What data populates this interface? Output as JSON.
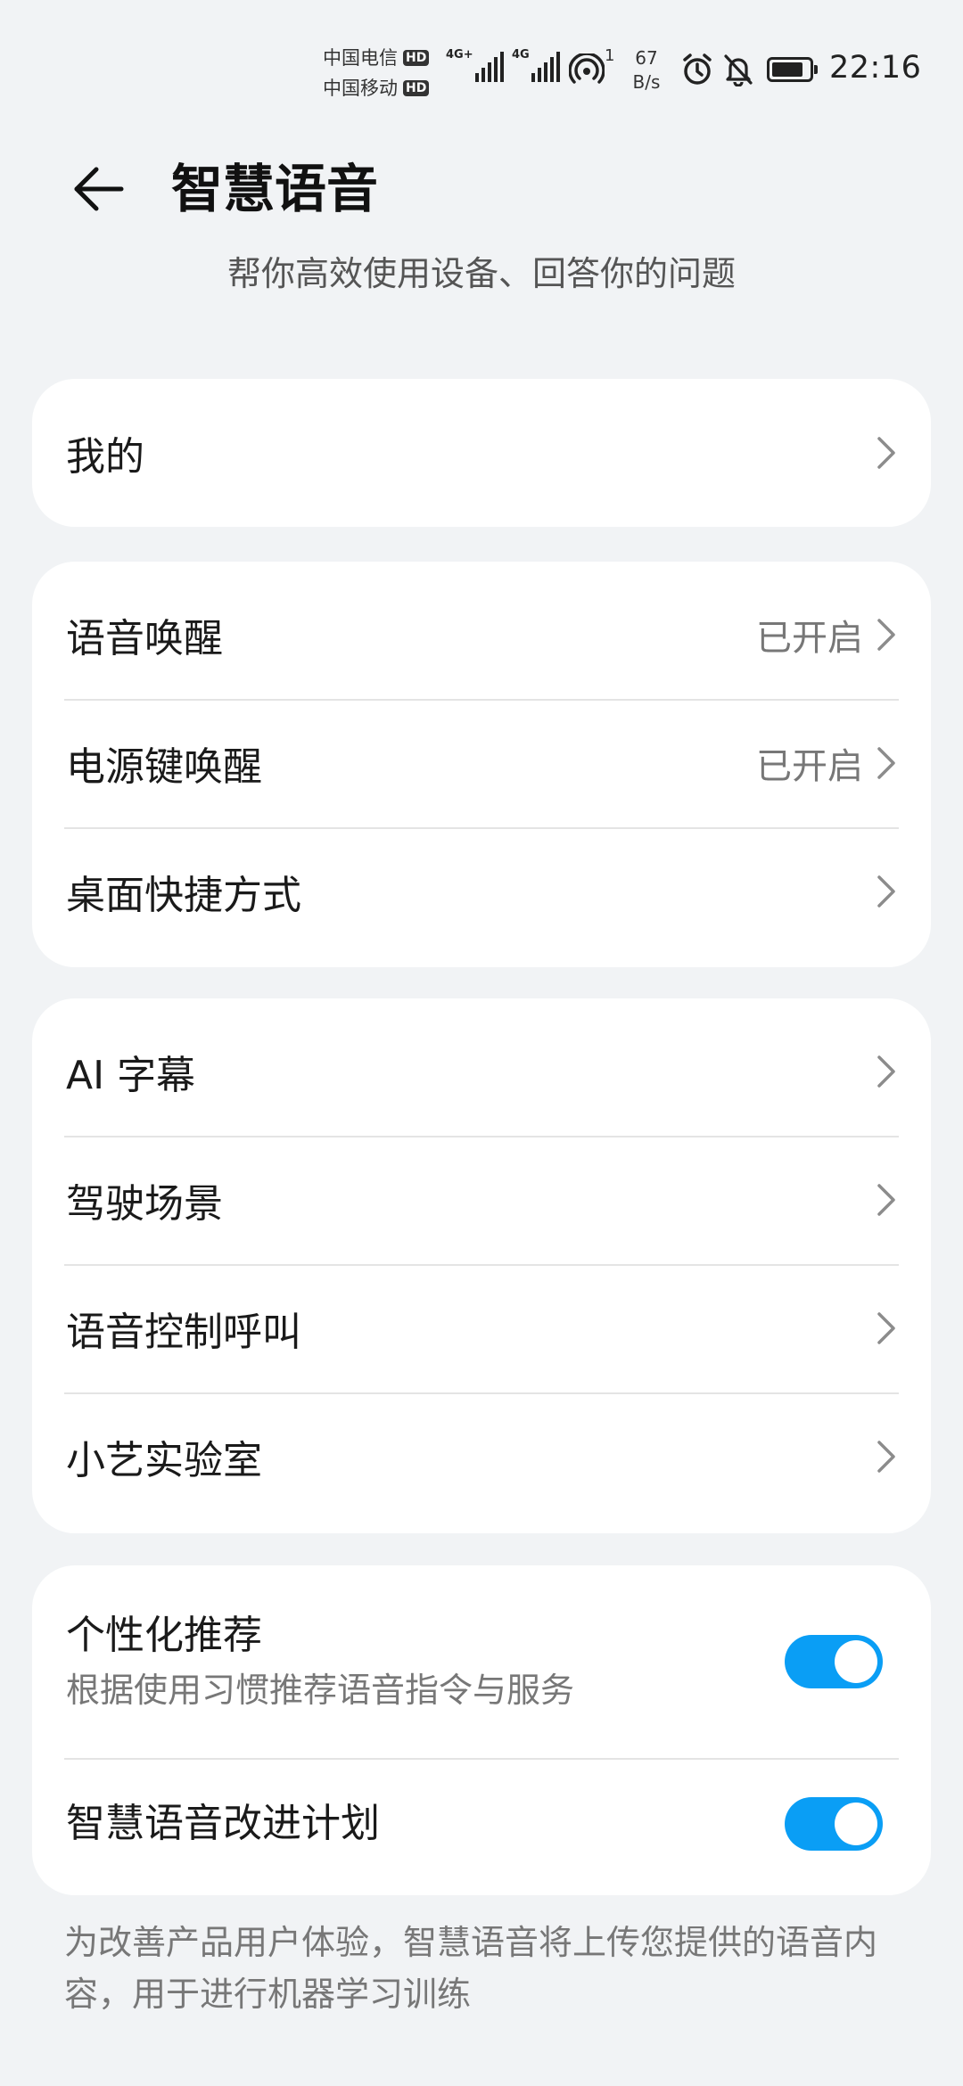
{
  "status_bar": {
    "carrier1": "中国电信",
    "carrier2": "中国移动",
    "hd": "HD",
    "sim1_network": "4G+",
    "sim2_network": "4G",
    "hotspot_count": "1",
    "net_speed_value": "67",
    "net_speed_unit": "B/s",
    "time": "22:16",
    "icons": [
      "signal-icon",
      "hotspot-icon",
      "alarm-icon",
      "mute-bell-icon",
      "battery-icon"
    ]
  },
  "header": {
    "title": "智慧语音",
    "subtitle": "帮你高效使用设备、回答你的问题"
  },
  "group1": {
    "items": [
      {
        "label": "我的"
      }
    ]
  },
  "group2": {
    "items": [
      {
        "label": "语音唤醒",
        "value": "已开启"
      },
      {
        "label": "电源键唤醒",
        "value": "已开启"
      },
      {
        "label": "桌面快捷方式"
      }
    ]
  },
  "group3": {
    "items": [
      {
        "label": "AI 字幕"
      },
      {
        "label": "驾驶场景"
      },
      {
        "label": "语音控制呼叫"
      },
      {
        "label": "小艺实验室"
      }
    ]
  },
  "group4": {
    "personalized": {
      "title": "个性化推荐",
      "subtitle": "根据使用习惯推荐语音指令与服务",
      "enabled": true
    },
    "improvement": {
      "title": "智慧语音改进计划",
      "enabled": true
    }
  },
  "footer_note": "为改善产品用户体验，智慧语音将上传您提供的语音内容，用于进行机器学习训练",
  "colors": {
    "background": "#f1f3f5",
    "card": "#ffffff",
    "toggle_on": "#0a9ef5",
    "secondary_text": "#777777"
  }
}
